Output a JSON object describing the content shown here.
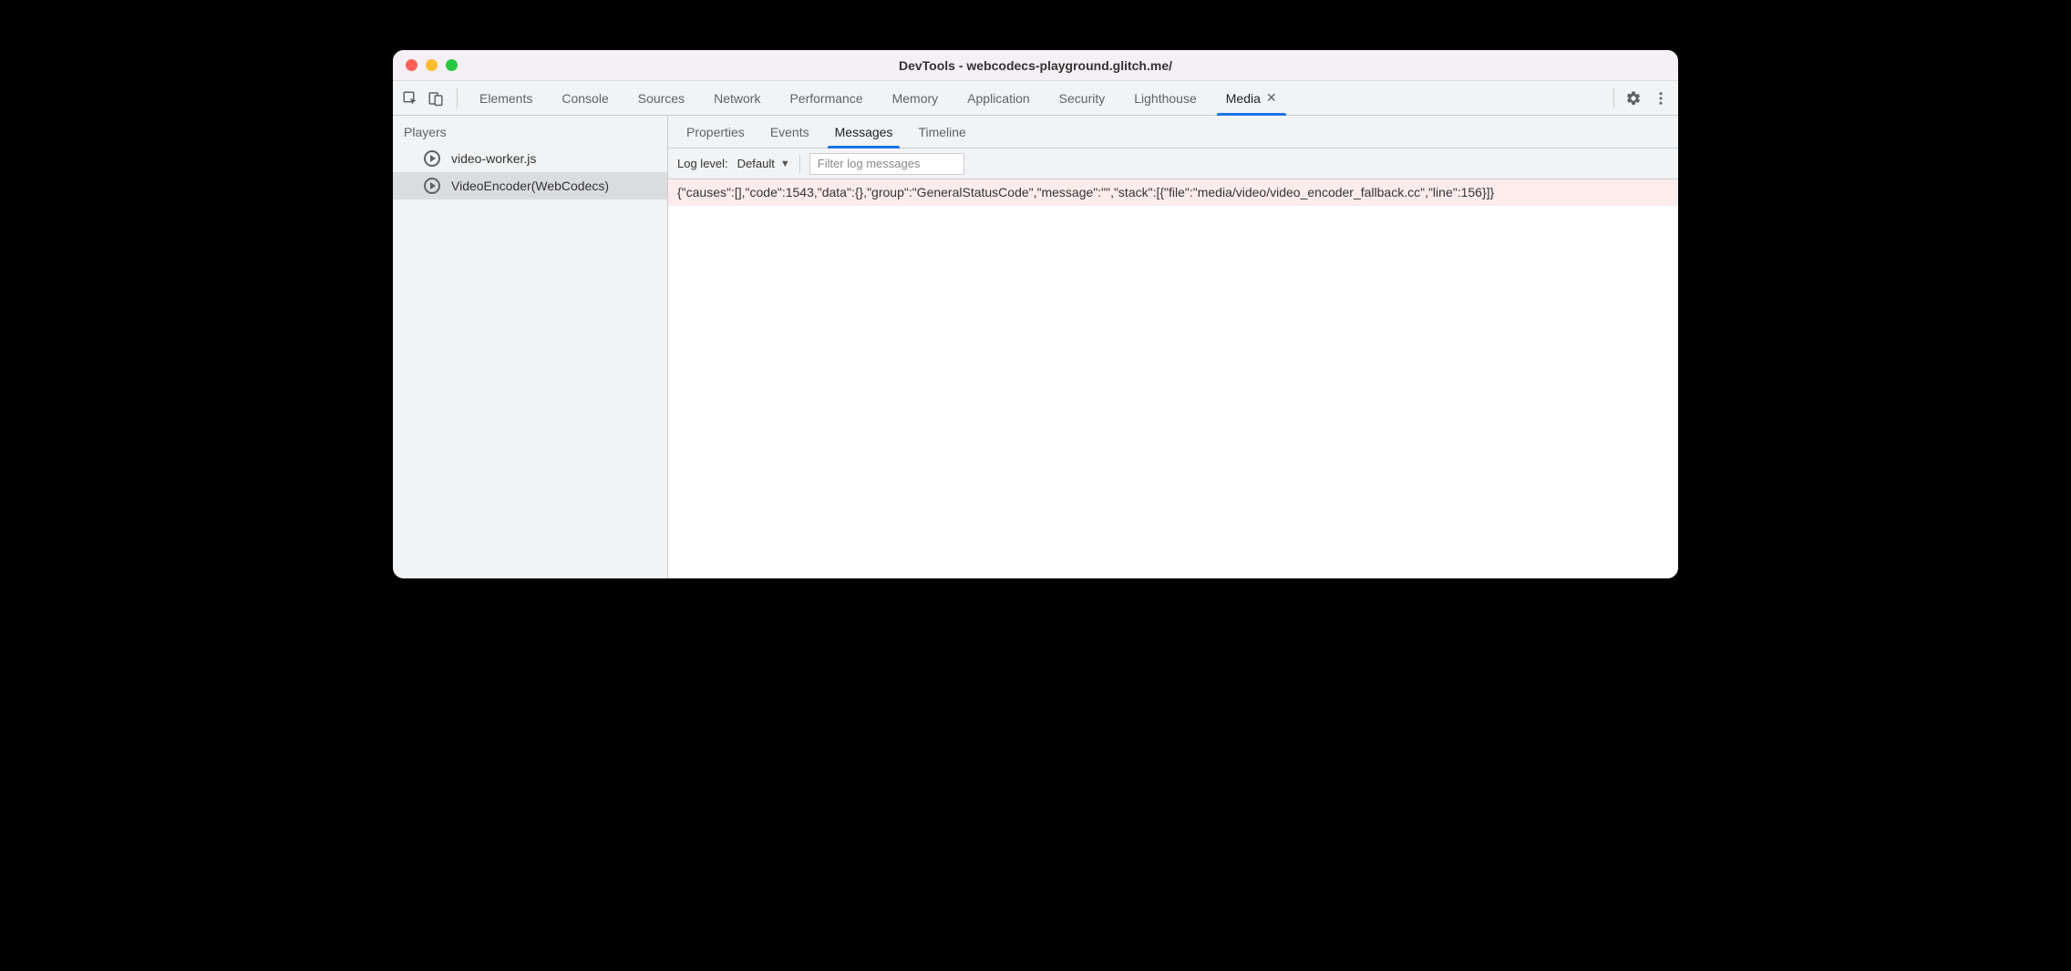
{
  "window_title": "DevTools - webcodecs-playground.glitch.me/",
  "main_tabs": [
    {
      "label": "Elements",
      "active": false
    },
    {
      "label": "Console",
      "active": false
    },
    {
      "label": "Sources",
      "active": false
    },
    {
      "label": "Network",
      "active": false
    },
    {
      "label": "Performance",
      "active": false
    },
    {
      "label": "Memory",
      "active": false
    },
    {
      "label": "Application",
      "active": false
    },
    {
      "label": "Security",
      "active": false
    },
    {
      "label": "Lighthouse",
      "active": false
    },
    {
      "label": "Media",
      "active": true,
      "closable": true
    }
  ],
  "sidebar": {
    "title": "Players",
    "items": [
      {
        "label": "video-worker.js",
        "selected": false
      },
      {
        "label": "VideoEncoder(WebCodecs)",
        "selected": true
      }
    ]
  },
  "sub_tabs": [
    {
      "label": "Properties",
      "active": false
    },
    {
      "label": "Events",
      "active": false
    },
    {
      "label": "Messages",
      "active": true
    },
    {
      "label": "Timeline",
      "active": false
    }
  ],
  "filterbar": {
    "log_level_label": "Log level:",
    "log_level_value": "Default",
    "filter_placeholder": "Filter log messages"
  },
  "logs": [
    {
      "level": "error",
      "text": "{\"causes\":[],\"code\":1543,\"data\":{},\"group\":\"GeneralStatusCode\",\"message\":\"\",\"stack\":[{\"file\":\"media/video/video_encoder_fallback.cc\",\"line\":156}]}"
    }
  ]
}
